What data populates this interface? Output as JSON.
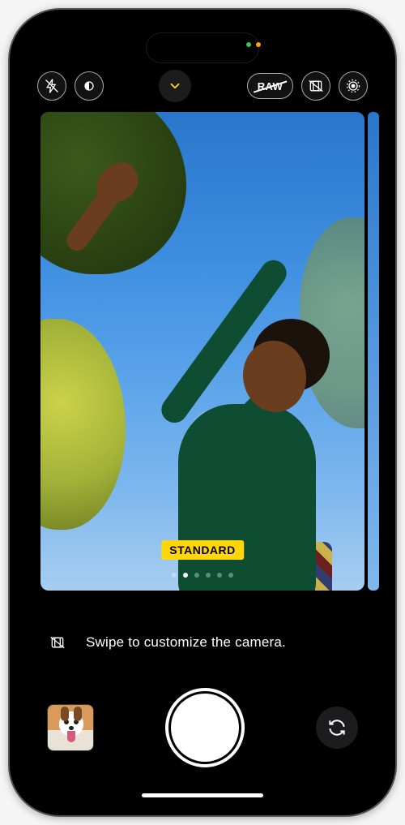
{
  "topbar": {
    "flash": "flash-off",
    "nightmode": "night-mode",
    "chevron": "expand-controls",
    "raw_label": "RAW",
    "raw_strike": true,
    "styles_icon": "photographic-styles",
    "livephoto_icon": "live-photo"
  },
  "viewfinder": {
    "style_badge": "STANDARD",
    "page_index": 1,
    "page_count": 6
  },
  "hint": {
    "icon": "photographic-styles",
    "text": "Swipe to customize the camera."
  },
  "bottombar": {
    "thumbnail_desc": "last-photo-thumbnail",
    "shutter": "shutter",
    "switch": "switch-camera"
  }
}
